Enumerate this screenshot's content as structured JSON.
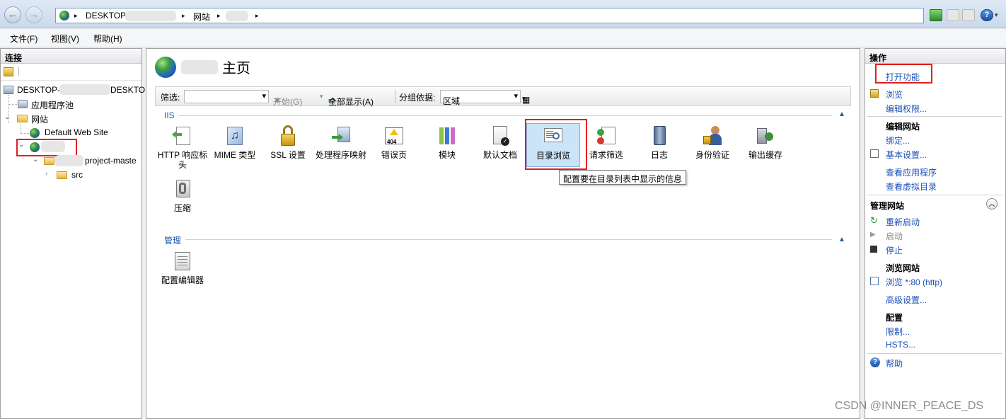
{
  "address": {
    "segments": [
      "DESKTOP",
      "网站"
    ],
    "separator": "▸"
  },
  "menu": [
    "文件(F)",
    "视图(V)",
    "帮助(H)"
  ],
  "connections": {
    "header": "连接",
    "server": "DESKTOP-",
    "server_suffix": "DESKTO",
    "app_pools": "应用程序池",
    "sites": "网站",
    "default_site": "Default Web Site",
    "project": "project-maste",
    "src": "src"
  },
  "center": {
    "title": "主页",
    "filter_label": "筛选:",
    "start_label": "开始(G)",
    "show_all_label": "全部显示(A)",
    "group_by_label": "分组依据:",
    "group_by_value": "区域",
    "group_iis": "IIS",
    "group_manage": "管理",
    "features": [
      {
        "label": "HTTP 响应标头"
      },
      {
        "label": "MIME 类型"
      },
      {
        "label": "SSL 设置"
      },
      {
        "label": "处理程序映射"
      },
      {
        "label": "错误页"
      },
      {
        "label": "模块"
      },
      {
        "label": "默认文档"
      },
      {
        "label": "目录浏览"
      },
      {
        "label": "请求筛选"
      },
      {
        "label": "日志"
      },
      {
        "label": "身份验证"
      },
      {
        "label": "输出缓存"
      },
      {
        "label": "压缩"
      }
    ],
    "manage_features": [
      {
        "label": "配置编辑器"
      }
    ],
    "tooltip": "配置要在目录列表中显示的信息",
    "error_icon_text": "404"
  },
  "actions": {
    "header": "操作",
    "open_feature": "打开功能",
    "browse": "浏览",
    "edit_permissions": "编辑权限...",
    "edit_site": "编辑网站",
    "bindings": "绑定...",
    "basic_settings": "基本设置...",
    "view_apps": "查看应用程序",
    "view_vdirs": "查看虚拟目录",
    "manage_site": "管理网站",
    "restart": "重新启动",
    "start": "启动",
    "stop": "停止",
    "browse_site": "浏览网站",
    "browse_80": "浏览 *:80 (http)",
    "advanced": "高级设置...",
    "config": "配置",
    "limits": "限制...",
    "hsts": "HSTS...",
    "help": "帮助"
  },
  "watermark": "CSDN @INNER_PEACE_DS",
  "colors": {
    "link": "#1a50b6",
    "highlight_red": "#e02020",
    "selected_bg": "#cce4f7"
  }
}
